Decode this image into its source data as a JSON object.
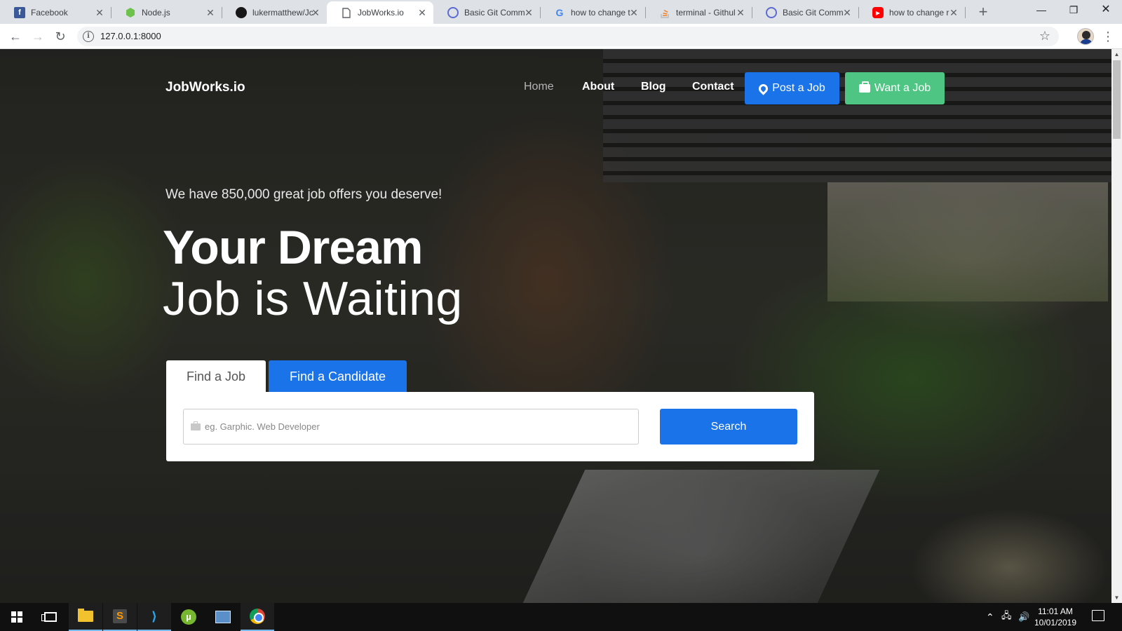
{
  "browser": {
    "tabs": [
      {
        "title": "Facebook",
        "icon": "facebook-icon",
        "icon_color": "#3b5998",
        "glyph": "f"
      },
      {
        "title": "Node.js",
        "icon": "nodejs-icon",
        "icon_color": "#6cc24a",
        "glyph": ""
      },
      {
        "title": "lukermatthew/Jc",
        "icon": "github-icon",
        "icon_color": "#181717",
        "glyph": ""
      },
      {
        "title": "JobWorks.io",
        "icon": "page-icon",
        "icon_color": "#ffffff",
        "glyph": ""
      },
      {
        "title": "Basic Git Comma",
        "icon": "atlassian-icon",
        "icon_color": "#5b6bd1",
        "glyph": ""
      },
      {
        "title": "how to change t",
        "icon": "google-icon",
        "icon_color": "#ffffff",
        "glyph": "G"
      },
      {
        "title": "terminal - Githul",
        "icon": "stackoverflow-icon",
        "icon_color": "#f48024",
        "glyph": ""
      },
      {
        "title": "Basic Git Comma",
        "icon": "atlassian-icon",
        "icon_color": "#5b6bd1",
        "glyph": ""
      },
      {
        "title": "how to change r",
        "icon": "youtube-icon",
        "icon_color": "#ff0000",
        "glyph": "▶"
      }
    ],
    "active_tab_index": 3,
    "url": "127.0.0.1:8000"
  },
  "site": {
    "brand": "JobWorks.io",
    "nav": [
      {
        "label": "Home",
        "active": true
      },
      {
        "label": "About",
        "active": false
      },
      {
        "label": "Blog",
        "active": false
      },
      {
        "label": "Contact",
        "active": false
      }
    ],
    "post_job_label": "Post a Job",
    "want_job_label": "Want a Job",
    "colors": {
      "primary": "#1a73e8",
      "success": "#4ec583"
    }
  },
  "hero": {
    "subtitle": "We have 850,000 great job offers you deserve!",
    "headline_bold": "Your Dream",
    "headline_light": "Job is Waiting"
  },
  "search": {
    "tabs": [
      {
        "label": "Find a Job",
        "active": true
      },
      {
        "label": "Find a Candidate",
        "active": false
      }
    ],
    "placeholder": "eg. Garphic. Web Developer",
    "button_label": "Search"
  },
  "taskbar": {
    "apps": [
      "start-icon",
      "task-view-icon",
      "file-explorer-icon",
      "sublime-text-icon",
      "vscode-icon",
      "utorrent-icon",
      "remote-desktop-icon",
      "chrome-icon"
    ],
    "time": "11:01 AM",
    "date": "10/01/2019"
  }
}
